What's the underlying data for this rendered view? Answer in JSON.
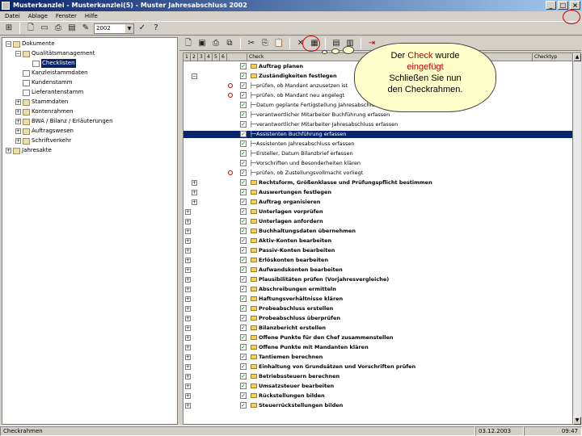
{
  "window": {
    "title": "Musterkanzlei - Musterkanzlei(5) - Muster Jahresabschluss 2002"
  },
  "menu": [
    "Datei",
    "Ablage",
    "Fenster",
    "Hilfe"
  ],
  "toolbar": {
    "year": "2002"
  },
  "tree": [
    {
      "label": "Dokumente",
      "level": 0,
      "exp": "−"
    },
    {
      "label": "Qualitätsmanagement",
      "level": 1,
      "exp": "−"
    },
    {
      "label": "Checklisten",
      "level": 2,
      "exp": "",
      "selected": true
    },
    {
      "label": "Kanzleistammdaten",
      "level": 1,
      "exp": ""
    },
    {
      "label": "Kundenstamm",
      "level": 1,
      "exp": ""
    },
    {
      "label": "Lieferantenstamm",
      "level": 1,
      "exp": ""
    },
    {
      "label": "Stammdaten",
      "level": 1,
      "exp": "+"
    },
    {
      "label": "Kontenrahmen",
      "level": 1,
      "exp": "+"
    },
    {
      "label": "BWA / Bilanz / Erläuterungen",
      "level": 1,
      "exp": "+"
    },
    {
      "label": "Auftragswesen",
      "level": 1,
      "exp": "+"
    },
    {
      "label": "Schriftverkehr",
      "level": 1,
      "exp": "+"
    },
    {
      "label": "Jahresakte",
      "level": 0,
      "exp": "+"
    }
  ],
  "grid": {
    "headers": [
      "Check",
      "Checktyp"
    ],
    "rows": [
      {
        "text": "Auftrag planen",
        "bold": true,
        "lvl": "",
        "mark": false,
        "checked": true,
        "folder": true,
        "sub": false
      },
      {
        "text": "Zuständigkeiten festlegen",
        "bold": true,
        "lvl": "−",
        "mark": false,
        "checked": true,
        "folder": true,
        "sub": false
      },
      {
        "text": "prüfen, ob Mandant anzusetzen ist",
        "bold": false,
        "lvl": "",
        "mark": true,
        "checked": true,
        "folder": false,
        "sub": true
      },
      {
        "text": "prüfen, ob Mandant neu angelegt",
        "bold": false,
        "lvl": "",
        "mark": true,
        "checked": true,
        "folder": false,
        "sub": true
      },
      {
        "text": "Datum geplante Fertigstellung Jahresabschluss",
        "bold": false,
        "lvl": "",
        "mark": false,
        "checked": true,
        "folder": false,
        "sub": true
      },
      {
        "text": "verantwortlicher Mitarbeiter Buchführung erfassen",
        "bold": false,
        "lvl": "",
        "mark": false,
        "checked": true,
        "folder": false,
        "sub": true
      },
      {
        "text": "verantwortlicher Mitarbeiter Jahresabschluss erfassen",
        "bold": false,
        "lvl": "",
        "mark": false,
        "checked": true,
        "folder": false,
        "sub": true
      },
      {
        "text": "Assistenten Buchführung erfassen",
        "bold": false,
        "lvl": "",
        "mark": false,
        "checked": true,
        "folder": false,
        "sub": true,
        "selected": true
      },
      {
        "text": "Assistenten Jahresabschluss erfassen",
        "bold": false,
        "lvl": "",
        "mark": false,
        "checked": true,
        "folder": false,
        "sub": true
      },
      {
        "text": "Ersteller, Datum Bilanzbrief erfassen",
        "bold": false,
        "lvl": "",
        "mark": false,
        "checked": true,
        "folder": false,
        "sub": true
      },
      {
        "text": "Vorschriften und Besonderheiten klären",
        "bold": false,
        "lvl": "",
        "mark": false,
        "checked": true,
        "folder": false,
        "sub": true
      },
      {
        "text": "prüfen, ob Zustellungsvollmacht vorliegt",
        "bold": false,
        "lvl": "",
        "mark": true,
        "checked": true,
        "folder": false,
        "sub": true
      },
      {
        "text": "Rechtsform, Größenklasse und Prüfungspflicht bestimmen",
        "bold": true,
        "lvl": "+",
        "mark": false,
        "checked": true,
        "folder": true,
        "sub": false
      },
      {
        "text": "Auswertungen festlegen",
        "bold": true,
        "lvl": "+",
        "mark": false,
        "checked": true,
        "folder": true,
        "sub": false
      },
      {
        "text": "Auftrag organisieren",
        "bold": true,
        "lvl": "+",
        "mark": false,
        "checked": true,
        "folder": true,
        "sub": false
      },
      {
        "text": "Unterlagen vorprüfen",
        "bold": true,
        "lvl": "+",
        "mark": false,
        "checked": true,
        "folder": true,
        "sub": false
      },
      {
        "text": "Unterlagen anfordern",
        "bold": true,
        "lvl": "+",
        "mark": false,
        "checked": true,
        "folder": true,
        "sub": false
      },
      {
        "text": "Buchhaltungsdaten übernehmen",
        "bold": true,
        "lvl": "+",
        "mark": false,
        "checked": true,
        "folder": true,
        "sub": false
      },
      {
        "text": "Aktiv-Konten bearbeiten",
        "bold": true,
        "lvl": "+",
        "mark": false,
        "checked": true,
        "folder": true,
        "sub": false
      },
      {
        "text": "Passiv-Konten bearbeiten",
        "bold": true,
        "lvl": "+",
        "mark": false,
        "checked": true,
        "folder": true,
        "sub": false
      },
      {
        "text": "Erlöskonten bearbeiten",
        "bold": true,
        "lvl": "+",
        "mark": false,
        "checked": true,
        "folder": true,
        "sub": false
      },
      {
        "text": "Aufwandskonten bearbeiten",
        "bold": true,
        "lvl": "+",
        "mark": false,
        "checked": true,
        "folder": true,
        "sub": false
      },
      {
        "text": "Plausibilitäten prüfen (Vorjahresvergleiche)",
        "bold": true,
        "lvl": "+",
        "mark": false,
        "checked": true,
        "folder": true,
        "sub": false
      },
      {
        "text": "Abschreibungen ermitteln",
        "bold": true,
        "lvl": "+",
        "mark": false,
        "checked": true,
        "folder": true,
        "sub": false
      },
      {
        "text": "Haftungsverhältnisse klären",
        "bold": true,
        "lvl": "+",
        "mark": false,
        "checked": true,
        "folder": true,
        "sub": false
      },
      {
        "text": "Probeabschluss erstellen",
        "bold": true,
        "lvl": "+",
        "mark": false,
        "checked": true,
        "folder": true,
        "sub": false
      },
      {
        "text": "Probeabschluss überprüfen",
        "bold": true,
        "lvl": "+",
        "mark": false,
        "checked": true,
        "folder": true,
        "sub": false
      },
      {
        "text": "Bilanzbericht erstellen",
        "bold": true,
        "lvl": "+",
        "mark": false,
        "checked": true,
        "folder": true,
        "sub": false
      },
      {
        "text": "Offene Punkte für den Chef zusammenstellen",
        "bold": true,
        "lvl": "+",
        "mark": false,
        "checked": true,
        "folder": true,
        "sub": false
      },
      {
        "text": "Offene Punkte mit Mandanten klären",
        "bold": true,
        "lvl": "+",
        "mark": false,
        "checked": true,
        "folder": true,
        "sub": false
      },
      {
        "text": "Tantiemen berechnen",
        "bold": true,
        "lvl": "+",
        "mark": false,
        "checked": true,
        "folder": true,
        "sub": false
      },
      {
        "text": "Einhaltung von Grundsätzen und Vorschriften prüfen",
        "bold": true,
        "lvl": "+",
        "mark": false,
        "checked": true,
        "folder": true,
        "sub": false
      },
      {
        "text": "Betriebssteuern berechnen",
        "bold": true,
        "lvl": "+",
        "mark": false,
        "checked": true,
        "folder": true,
        "sub": false
      },
      {
        "text": "Umsatzsteuer bearbeiten",
        "bold": true,
        "lvl": "+",
        "mark": false,
        "checked": true,
        "folder": true,
        "sub": false
      },
      {
        "text": "Rückstellungen bilden",
        "bold": true,
        "lvl": "+",
        "mark": false,
        "checked": true,
        "folder": true,
        "sub": false
      },
      {
        "text": "Steuerrückstellungen bilden",
        "bold": true,
        "lvl": "+",
        "mark": false,
        "checked": true,
        "folder": true,
        "sub": false
      }
    ]
  },
  "callout": {
    "line1a": "Der ",
    "line1b": "Check",
    "line1c": " wurde",
    "line2": "eingefügt",
    "line3": "Schließen Sie nun",
    "line4": "den Checkrahmen."
  },
  "status": {
    "left": "Checkrahmen",
    "date": "03.12.2003",
    "time": "09:47"
  },
  "icons": [
    "new-icon",
    "open-icon",
    "print-icon",
    "save-icon",
    "cut-icon",
    "copy-icon",
    "paste-icon",
    "delete-icon",
    "close-frame-icon"
  ]
}
